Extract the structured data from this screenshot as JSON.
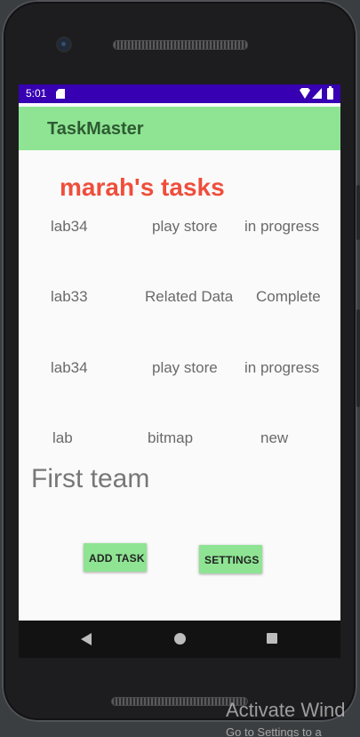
{
  "status_bar": {
    "time": "5:01",
    "icons": [
      "sd-card-icon",
      "wifi-icon",
      "signal-icon",
      "battery-icon"
    ]
  },
  "app_bar": {
    "title": "TaskMaster"
  },
  "heading": "marah's tasks",
  "tasks": [
    {
      "title": "lab34",
      "body": "play store",
      "state": "in progress"
    },
    {
      "title": "lab33",
      "body": "Related Data",
      "state": "Complete"
    },
    {
      "title": "lab34",
      "body": "play store",
      "state": "in progress"
    },
    {
      "title": "lab",
      "body": "bitmap",
      "state": "new"
    }
  ],
  "team": "First team",
  "buttons": {
    "add_task": "ADD TASK",
    "settings": "SETTINGS"
  },
  "nav": {
    "icons": [
      "back-icon",
      "home-icon",
      "recents-icon"
    ]
  },
  "watermark": {
    "title": "Activate Wind",
    "subtitle": "Go to Settings to a"
  },
  "colors": {
    "status_bar": "#3700b3",
    "app_bar": "#8ee493",
    "heading": "#ef4e3c",
    "button": "#8ee493"
  }
}
